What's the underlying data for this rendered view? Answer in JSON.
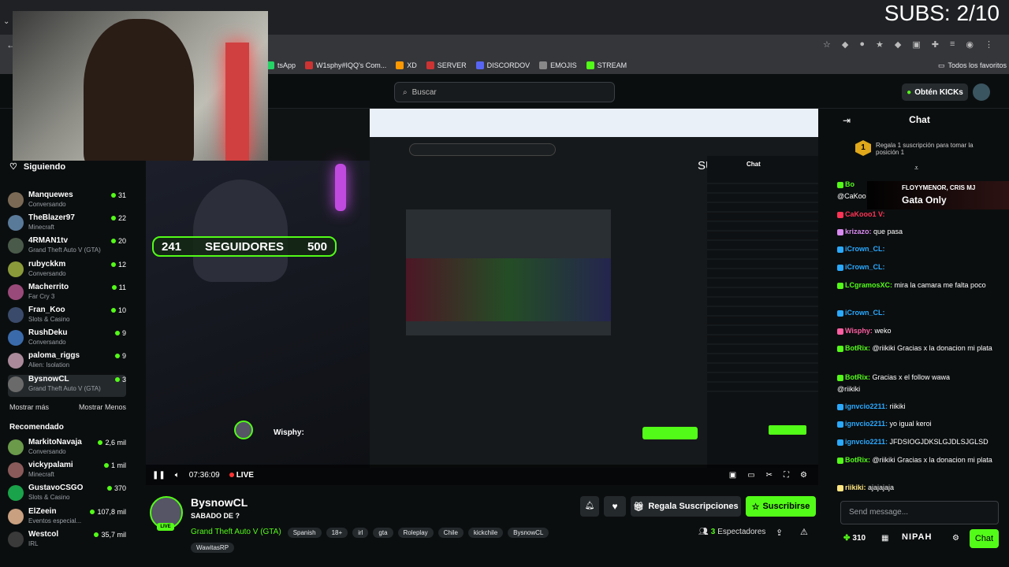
{
  "overlay": {
    "subs": "SUBS: 2/10",
    "followers_left": "241",
    "followers_label": "SEGUIDORES",
    "followers_right": "500"
  },
  "bookmarks": [
    {
      "label": "tsApp",
      "color": "#25d366"
    },
    {
      "label": "W1sphy#IQQ's Com...",
      "color": "#c33"
    },
    {
      "label": "XD",
      "color": "#f90"
    },
    {
      "label": "SERVER",
      "color": "#c33"
    },
    {
      "label": "DISCORDOV",
      "color": "#5865f2"
    },
    {
      "label": "EMOJIS",
      "color": "#888"
    },
    {
      "label": "STREAM",
      "color": "#53fc18"
    }
  ],
  "bookmarks_all": "Todos los favoritos",
  "header": {
    "search_placeholder": "Buscar",
    "kicks_label": "Obtén KICKs"
  },
  "sidebar": {
    "following_label": "Siguiendo",
    "following": [
      {
        "name": "Manquewes",
        "game": "Conversando",
        "viewers": "31",
        "color": "#7a6a55"
      },
      {
        "name": "TheBlazer97",
        "game": "Minecraft",
        "viewers": "22",
        "color": "#5a7a9a"
      },
      {
        "name": "4RMAN1tv",
        "game": "Grand Theft Auto V (GTA)",
        "viewers": "20",
        "color": "#4a5a4a"
      },
      {
        "name": "rubyckkm",
        "game": "Conversando",
        "viewers": "12",
        "color": "#8a9a3a"
      },
      {
        "name": "Macherrito",
        "game": "Far Cry 3",
        "viewers": "11",
        "color": "#9a4a7a"
      },
      {
        "name": "Fran_Koo",
        "game": "Slots & Casino",
        "viewers": "10",
        "color": "#3a4a6a"
      },
      {
        "name": "RushDeku",
        "game": "Conversando",
        "viewers": "9",
        "color": "#3a6aaa"
      },
      {
        "name": "paloma_riggs",
        "game": "Alien: Isolation",
        "viewers": "9",
        "color": "#aa8a9a"
      },
      {
        "name": "BysnowCL",
        "game": "Grand Theft Auto V (GTA)",
        "viewers": "3",
        "color": "#6a6a6a"
      }
    ],
    "show_more": "Mostrar más",
    "show_less": "Mostrar Menos",
    "recommended_label": "Recomendado",
    "recommended": [
      {
        "name": "MarkitoNavaja",
        "game": "Conversando",
        "viewers": "2,6 mil",
        "color": "#6a9a4a"
      },
      {
        "name": "vickypalami",
        "game": "Minecraft",
        "viewers": "1 mil",
        "color": "#8a5a5a"
      },
      {
        "name": "GustavoCSGO",
        "game": "Slots & Casino",
        "viewers": "370",
        "color": "#1aa34a"
      },
      {
        "name": "ElZeein",
        "game": "Eventos especial...",
        "viewers": "107,8 mil",
        "color": "#c9a080"
      },
      {
        "name": "Westcol",
        "game": "IRL",
        "viewers": "35,7 mil",
        "color": "#3a3a3a"
      }
    ]
  },
  "player": {
    "time": "07:36:09",
    "live": "LIVE"
  },
  "stream": {
    "name": "BysnowCL",
    "title": "SABADO DE ?",
    "live_badge": "LIVE",
    "category": "Grand Theft Auto V (GTA)",
    "tags": [
      "Spanish",
      "18+",
      "irl",
      "gta",
      "Roleplay",
      "Chile",
      "kickchile",
      "BysnowCL",
      "WawitasRP"
    ],
    "gift_label": "Regala Suscripciones",
    "subscribe_label": "Suscribirse",
    "viewers": "3",
    "viewers_label": "Espectadores"
  },
  "chat": {
    "title": "Chat",
    "gift_banner": "Regala 1 suscripción para tomar la posición 1",
    "gift_rank": "1",
    "popup_names": "FLOYYMENOR, CRIS MJ",
    "popup_title": "Gata Only",
    "messages": [
      {
        "user": "Bo",
        "text": "",
        "color": "#53fc18"
      },
      {
        "user": "",
        "text": "@CaKoo",
        "color": "#fff"
      },
      {
        "user": "CaKooo1 V:",
        "text": "",
        "color": "#ff3355"
      },
      {
        "user": "krizazo:",
        "text": "que pasa",
        "color": "#d98af0"
      },
      {
        "user": "iCrown_CL:",
        "text": "",
        "color": "#2aa9ff"
      },
      {
        "user": "iCrown_CL:",
        "text": "",
        "color": "#2aa9ff"
      },
      {
        "user": "LCgramosXC:",
        "text": "mira la camara me falta poco",
        "color": "#53fc18"
      },
      {
        "user": "iCrown_CL:",
        "text": "",
        "color": "#2aa9ff"
      },
      {
        "user": "Wisphy:",
        "text": "weko",
        "color": "#ff5fa2"
      },
      {
        "user": "BotRix:",
        "text": "@riikiki Gracias x la donacion mi plata",
        "color": "#53fc18"
      },
      {
        "user": "BotRix:",
        "text": "Gracias x el follow wawa",
        "color": "#53fc18"
      },
      {
        "user": "",
        "text": "@riikiki",
        "color": "#fff"
      },
      {
        "user": "ignvcio2211:",
        "text": "riikiki",
        "color": "#2aa9ff"
      },
      {
        "user": "ignvcio2211:",
        "text": "yo igual keroi",
        "color": "#2aa9ff"
      },
      {
        "user": "ignvcio2211:",
        "text": "JFDSIOGJDKSLGJDLSJGLSD",
        "color": "#2aa9ff"
      },
      {
        "user": "BotRix:",
        "text": "@riikiki Gracias x la donacion mi plata",
        "color": "#53fc18"
      },
      {
        "user": "riikiki:",
        "text": "ajajajaja",
        "color": "#ffe680"
      }
    ],
    "input_placeholder": "Send message...",
    "points": "310",
    "brand": "NIPAH",
    "send_label": "Chat"
  }
}
